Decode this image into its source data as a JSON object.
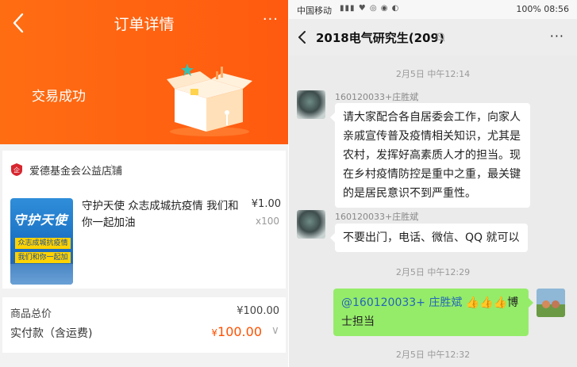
{
  "order": {
    "title": "订单详情",
    "more": "···",
    "status": "交易成功",
    "shop_name": "爱德基金会公益店铺",
    "shop_chevron": "〉",
    "product": {
      "image_title": "守护天使",
      "image_banner_1": "众志成城抗疫情",
      "image_banner_2": "我们和你一起加油",
      "name": "守护天使 众志成城抗疫情 我们和你一起加油",
      "price": "¥1.00",
      "quantity": "x100"
    },
    "summary": {
      "goods_total_label": "商品总价",
      "goods_total_value": "¥100.00",
      "paid_label": "实付款（含运费)",
      "paid_currency": "¥",
      "paid_value": "100.00",
      "paid_chevron": "∨"
    },
    "colors": {
      "header_orange": "#ff5a10",
      "price_red": "#ff5000"
    }
  },
  "chat": {
    "status_bar": {
      "carrier": "中国移动",
      "right": "100% 08:56"
    },
    "title": "2018电气研究生(209)",
    "more": "···",
    "messages": [
      {
        "time": "2月5日 中午12:14"
      },
      {
        "sender": "160120033+庄胜斌",
        "text": "请大家配合各自居委会工作，向家人亲戚宣传普及疫情相关知识，尤其是农村，发挥好高素质人才的担当。现在乡村疫情防控是重中之重，最关键的是居民意识不到严重性。"
      },
      {
        "sender": "160120033+庄胜斌",
        "text": "不要出门，电话、微信、QQ 就可以"
      },
      {
        "time": "2月5日 中午12:29"
      },
      {
        "mine": true,
        "mention": "@160120033+ 庄胜斌",
        "text": "博士担当"
      },
      {
        "time": "2月5日 中午12:32"
      }
    ],
    "colors": {
      "my_bubble": "#95ec69",
      "mention": "#2466b8"
    }
  }
}
